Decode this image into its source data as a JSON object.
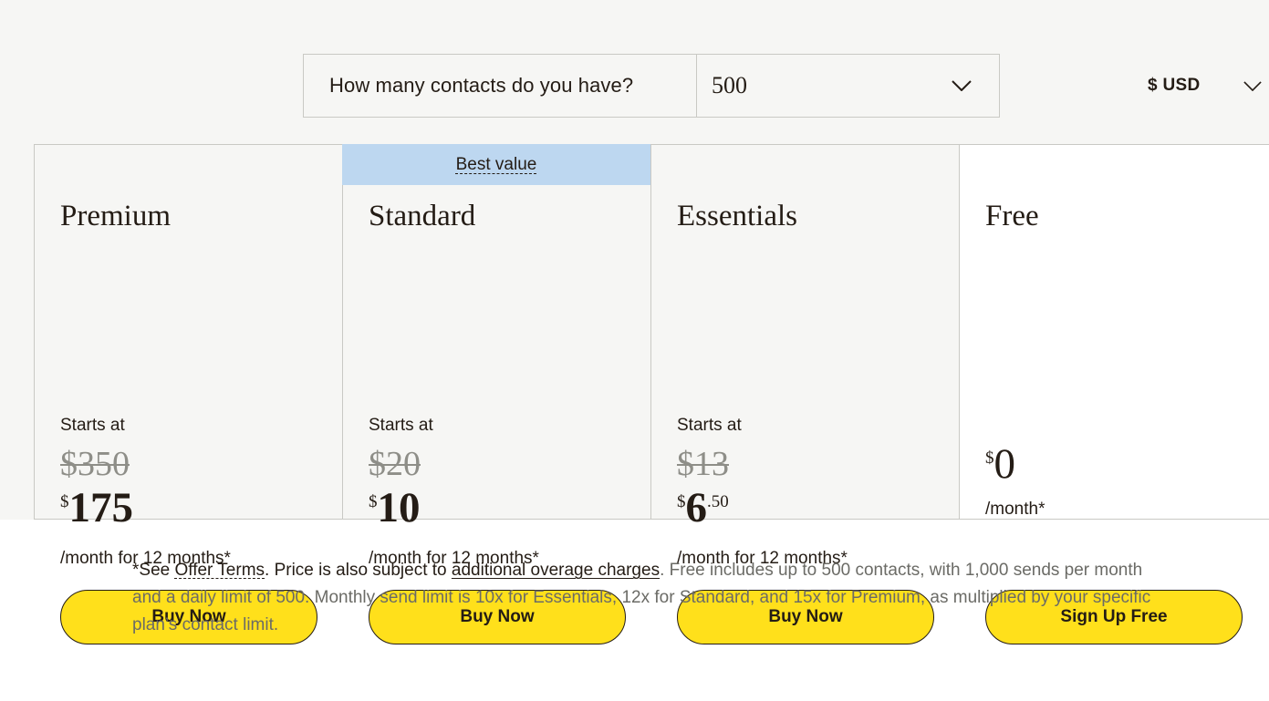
{
  "header": {
    "contact_question": "How many contacts do you have?",
    "contact_value": "500",
    "contact_chevron": "chevron-down-icon",
    "currency_label": "$ USD",
    "currency_chevron": "chevron-down-icon"
  },
  "plans": [
    {
      "name": "Premium",
      "banner": null,
      "starts_at": "Starts at",
      "old_price": "$350",
      "currency_symbol": "$",
      "price": "175",
      "cents": "",
      "period": "/month for 12 months*",
      "cta": "Buy Now"
    },
    {
      "name": "Standard",
      "banner": "Best value",
      "starts_at": "Starts at",
      "old_price": "$20",
      "currency_symbol": "$",
      "price": "10",
      "cents": "",
      "period": "/month for 12 months*",
      "cta": "Buy Now"
    },
    {
      "name": "Essentials",
      "banner": null,
      "starts_at": "Starts at",
      "old_price": "$13",
      "currency_symbol": "$",
      "price": "6",
      "cents": ".50",
      "period": "/month for 12 months*",
      "cta": "Buy Now"
    },
    {
      "name": "Free",
      "banner": null,
      "starts_at": "",
      "old_price": "",
      "currency_symbol": "$",
      "price": "0",
      "cents": "",
      "period": "/month*",
      "cta": "Sign Up Free"
    }
  ],
  "footnote": {
    "asterisk": "*See ",
    "link_terms": "Offer Terms",
    "after_terms": ". Price is also subject to ",
    "link_overage": "additional overage charges",
    "rest": ". Free includes up to 500 contacts, with 1,000 sends per month and a daily limit of 500. Monthly send limit is 10x for Essentials, 12x for Standard, and 15x for Premium, as multiplied by your specific plan’s contact limit."
  },
  "colors": {
    "cta_yellow": "#ffe01b",
    "banner_blue": "#bdd7f0",
    "page_grey": "#f6f6f4",
    "border_grey": "#c9c9c4",
    "text_dark": "#241c15",
    "text_muted": "#6b6b66",
    "strike_grey": "#8e8e88"
  }
}
